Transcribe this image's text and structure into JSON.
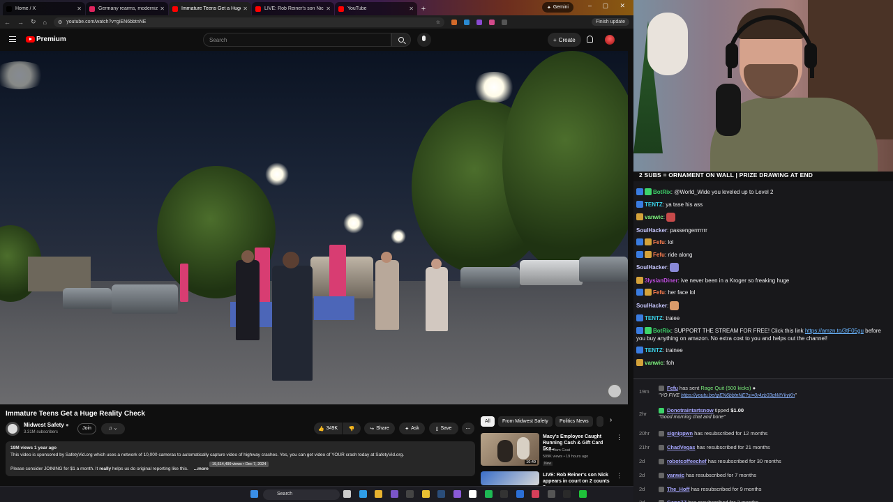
{
  "browser": {
    "tabs": [
      {
        "label": "Home / X",
        "active": false,
        "color": "#000000"
      },
      {
        "label": "Germany rearms, modernizes",
        "active": false,
        "color": "#e0245e"
      },
      {
        "label": "Immature Teens Get a Huge",
        "active": true,
        "color": "#ff0000"
      },
      {
        "label": "LIVE: Rob Reiner's son Nick ap",
        "active": false,
        "color": "#ff0000"
      },
      {
        "label": "YouTube",
        "active": false,
        "color": "#ff0000"
      }
    ],
    "new_tab": "+",
    "gemini": "Gemini",
    "url": "youtube.com/watch?v=giEN6bbtnNE",
    "finish_update": "Finish update"
  },
  "youtube": {
    "brand": "Premium",
    "search_placeholder": "Search",
    "create_label": "Create",
    "video": {
      "title": "Immature Teens Get a Huge Reality Check",
      "channel": "Midwest Safety",
      "subscribers": "3.31M subscribers",
      "join_label": "Join",
      "likes": "349K",
      "share_label": "Share",
      "ask_label": "Ask",
      "save_label": "Save",
      "views_line": "19M views  1 year ago",
      "description": "This video is sponsored by SafetyVid.org which uses a network of 10,000 cameras to automatically capture video of highway crashes. Yes, you can get video of YOUR crash today at SafetyVid.org.",
      "description2_a": "Please consider JOINING for $1 a month. It",
      "description2_b": "really",
      "description2_c": "helps us do original reporting like this.",
      "more": "...more",
      "tooltip": "19,614,499 views • Dec 7, 2024"
    },
    "chips": [
      "All",
      "From Midwest Safety",
      "Politics News"
    ],
    "recommendations": [
      {
        "title": "Macy's Employee Caught Running Cash & Gift Card Sca...",
        "channel": "Body Cam Goat",
        "meta": "509K views • 19 hours ago",
        "badge": "New",
        "duration": "16:49"
      },
      {
        "title": "LIVE: Rob Reiner's son Nick appears in court on 2 counts o...",
        "channel": "",
        "meta": "",
        "badge": "",
        "duration": ""
      }
    ]
  },
  "taskbar": {
    "search_label": "Search",
    "icons": [
      {
        "name": "windows-start-icon",
        "color": "#3a8ee6"
      },
      {
        "name": "task-view-icon",
        "color": "#cccccc"
      },
      {
        "name": "edge-icon",
        "color": "#2f9ee8"
      },
      {
        "name": "chrome-icon",
        "color": "#e8b32f"
      },
      {
        "name": "app-icon-1",
        "color": "#7a55c8"
      },
      {
        "name": "app-icon-2",
        "color": "#444444"
      },
      {
        "name": "file-explorer-icon",
        "color": "#e8c032"
      },
      {
        "name": "steam-icon",
        "color": "#2a4d7a"
      },
      {
        "name": "app-icon-3",
        "color": "#8a5ad8"
      },
      {
        "name": "notion-icon",
        "color": "#ffffff"
      },
      {
        "name": "spotify-icon",
        "color": "#1db954"
      },
      {
        "name": "obs-icon",
        "color": "#333333"
      },
      {
        "name": "app-icon-4",
        "color": "#2b6fd6"
      },
      {
        "name": "app-icon-5",
        "color": "#d63f5a"
      },
      {
        "name": "app-icon-6",
        "color": "#555555"
      },
      {
        "name": "app-icon-7",
        "color": "#2a2a2a"
      },
      {
        "name": "app-icon-8",
        "color": "#1fc23a"
      }
    ]
  },
  "stream": {
    "banner": "2 SUBS = ORNAMENT ON WALL | PRIZE DRAWING AT END",
    "chat": [
      {
        "user": "BotRix",
        "color": "#3dd36a",
        "text": "@World_Wide you leveled up to Level 2",
        "badges": [
          "#3a7ce0",
          "#3dd36a"
        ]
      },
      {
        "user": "TENTZ",
        "color": "#3ad1e8",
        "text": "ya tase his ass",
        "badges": [
          "#3a7ce0"
        ]
      },
      {
        "user": "vanwic",
        "color": "#7cf07c",
        "text": "",
        "badges": [
          "#d4a23a"
        ],
        "emote": "#c74a4a"
      },
      {
        "user": "SoulHacker",
        "color": "#c8c8ff",
        "text": "passengerrrrrrr",
        "badges": []
      },
      {
        "user": "Fefu",
        "color": "#ff7f50",
        "text": "lol",
        "badges": [
          "#3a7ce0",
          "#d4a23a"
        ]
      },
      {
        "user": "Fefu",
        "color": "#ff7f50",
        "text": "ride along",
        "badges": [
          "#3a7ce0",
          "#d4a23a"
        ]
      },
      {
        "user": "SoulHacker",
        "color": "#c8c8ff",
        "text": "",
        "badges": [],
        "emote": "#8a8ad8"
      },
      {
        "user": "3lysianDiner",
        "color": "#c04de0",
        "text": "ive never been in a Kroger so freaking huge",
        "badges": [
          "#d4a23a"
        ]
      },
      {
        "user": "Fefu",
        "color": "#ff7f50",
        "text": "her face lol",
        "badges": [
          "#3a7ce0",
          "#d4a23a"
        ]
      },
      {
        "user": "SoulHacker",
        "color": "#c8c8ff",
        "text": "",
        "badges": [],
        "emote": "#d89a6a"
      },
      {
        "user": "TENTZ",
        "color": "#3ad1e8",
        "text": "traiee",
        "badges": [
          "#3a7ce0"
        ]
      },
      {
        "user": "BotRix",
        "color": "#3dd36a",
        "text": "SUPPORT THE STREAM FOR FREE! Click this link",
        "link": "https://amzn.to/3tF05gu",
        "text2": "before you buy anything on amazon. No extra cost to you and helps out the channel!",
        "badges": [
          "#3a7ce0",
          "#3dd36a"
        ]
      },
      {
        "user": "TENTZ",
        "color": "#3ad1e8",
        "text": "trainee",
        "badges": [
          "#3a7ce0"
        ]
      },
      {
        "user": "vanwic",
        "color": "#7cf07c",
        "text": "foh",
        "badges": [
          "#d4a23a"
        ]
      }
    ],
    "events": [
      {
        "time": "19m",
        "user": "Fefu",
        "action": "has sent",
        "item": "Rage Quit (500 kicks)",
        "quote_prefix": "\"YO FIVE",
        "link": "https://youtu.be/giEN6bbtnNE?si=0r4zb33qWtYkyKh",
        "quote_suffix": "\""
      },
      {
        "time": "2hr",
        "user": "Donotraintartsnow",
        "action": "tipped",
        "amount": "$1.00",
        "quote": "\"Good morning chat and bone\""
      },
      {
        "time": "20hr",
        "user": "signippwn",
        "action": "has resubscribed for 12 months"
      },
      {
        "time": "21hr",
        "user": "ChadVegas",
        "action": "has resubscribed for 21 months"
      },
      {
        "time": "2d",
        "user": "robotcoffeechef",
        "action": "has resubscribed for 30 months"
      },
      {
        "time": "2d",
        "user": "vanwic",
        "action": "has resubscribed for 7 months"
      },
      {
        "time": "2d",
        "user": "The_Hoff",
        "action": "has resubscribed for 9 months"
      },
      {
        "time": "2d",
        "user": "GenoZZ",
        "action": "has resubscribed for 3 months"
      }
    ]
  }
}
